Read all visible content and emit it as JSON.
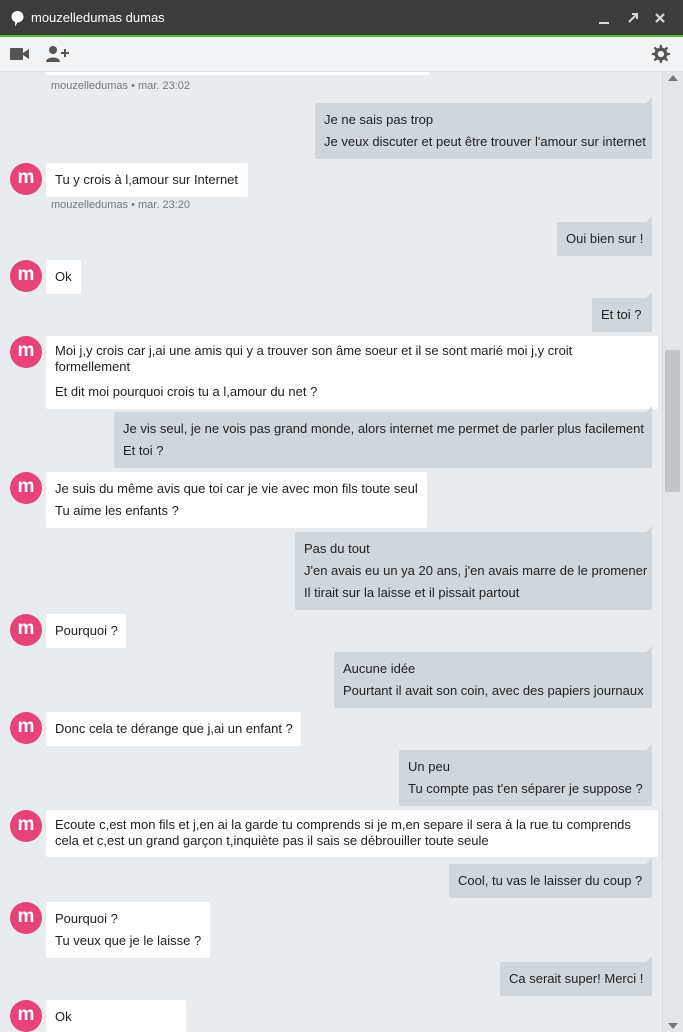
{
  "window": {
    "title": "mouzelledumas dumas",
    "accent_color": "#4fc12a",
    "titlebar_color": "#3c3c3c",
    "avatar_color": "#e64478"
  },
  "icons": [
    "pin-icon",
    "minimize-icon",
    "popout-icon",
    "close-icon",
    "video-call-icon",
    "add-person-icon",
    "settings-gear-icon"
  ],
  "messages": {
    "m1_meta": "mouzelledumas • mar. 23:02",
    "o1": [
      "Je ne sais pas trop",
      "Je veux discuter et peut être trouver l'amour sur internet"
    ],
    "i1": [
      "Tu y crois à l,amour sur Internet"
    ],
    "i1_meta": "mouzelledumas • mar. 23:20",
    "o2": [
      "Oui bien sur !"
    ],
    "i2": [
      "Ok"
    ],
    "o3": [
      "Et toi ?"
    ],
    "i3": [
      "Moi j,y crois car j,ai une amis qui y a trouver son âme soeur et il se sont marié moi j,y croit formellement",
      "Et dit moi pourquoi crois tu a l,amour du net ?"
    ],
    "o4": [
      "Je vis seul, je ne vois pas grand monde, alors internet me permet de parler plus facilement",
      "Et toi ?"
    ],
    "i4": [
      "Je suis du même avis que toi car je vie avec mon fils toute seul",
      "Tu aime les enfants ?"
    ],
    "o5": [
      "Pas du tout",
      "J'en avais eu un ya 20 ans, j'en avais marre de le promener",
      "Il tirait sur la laisse et il pissait partout"
    ],
    "i5": [
      "Pourquoi ?"
    ],
    "o6": [
      "Aucune idée",
      "Pourtant il avait son coin, avec des papiers journaux"
    ],
    "i6": [
      "Donc cela te dérange que j,ai un enfant ?"
    ],
    "o7": [
      "Un peu",
      "Tu compte pas t'en séparer je suppose ?"
    ],
    "i7": [
      "Ecoute c,est mon fils et j,en ai la garde tu comprends si je m,en separe il sera à la rue tu comprends cela et c,est un grand garçon t,inquiète pas il sais se débrouiller toute seule"
    ],
    "o8": [
      "Cool, tu vas le laisser du coup ?"
    ],
    "i8": [
      "Pourquoi ?",
      "Tu veux que je le laisse ?"
    ],
    "o9": [
      "Ca serait super! Merci !"
    ],
    "i9": [
      "Ok"
    ],
    "avatar_letter": "m"
  }
}
